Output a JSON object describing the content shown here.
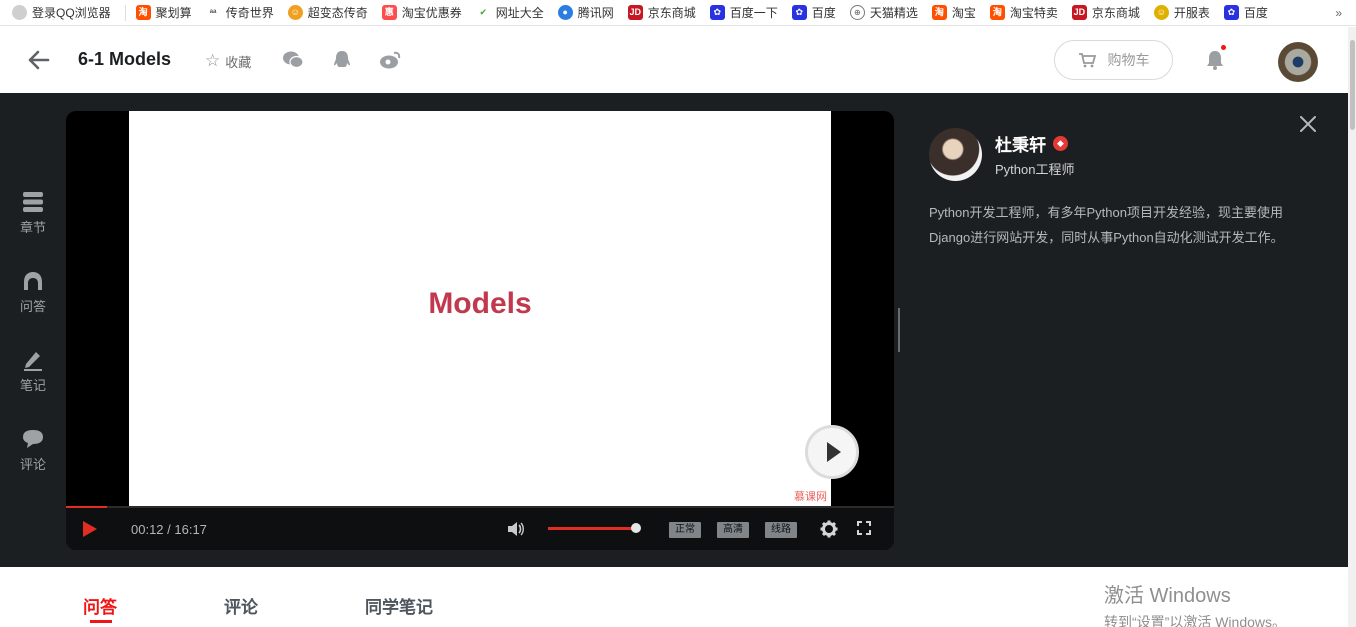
{
  "bookmarks": [
    {
      "label": "登录QQ浏览器",
      "icon": "user-icon",
      "color": "#cfcfcf"
    },
    {
      "label": "聚划算",
      "icon": "taobao-icon",
      "color": "#ff5000"
    },
    {
      "label": "传奇世界",
      "icon": "game-icon",
      "color": "#555555"
    },
    {
      "label": "超变态传奇",
      "icon": "smile-icon",
      "color": "#f0a020"
    },
    {
      "label": "淘宝优惠券",
      "icon": "coupon-icon",
      "color": "#ff4d4d"
    },
    {
      "label": "网址大全",
      "icon": "hao123-icon",
      "color": "#3fae29"
    },
    {
      "label": "腾讯网",
      "icon": "tencent-icon",
      "color": "#2a7de1"
    },
    {
      "label": "京东商城",
      "icon": "jd-icon",
      "color": "#c81623"
    },
    {
      "label": "百度一下",
      "icon": "baidu-icon",
      "color": "#2932e1"
    },
    {
      "label": "百度",
      "icon": "baidu-icon",
      "color": "#2932e1"
    },
    {
      "label": "天猫精选",
      "icon": "globe-icon",
      "color": "#777777"
    },
    {
      "label": "淘宝",
      "icon": "taobao-icon",
      "color": "#ff5000"
    },
    {
      "label": "淘宝特卖",
      "icon": "taobao-icon",
      "color": "#ff5000"
    },
    {
      "label": "京东商城",
      "icon": "jd-icon",
      "color": "#c81623"
    },
    {
      "label": "开服表",
      "icon": "smile-icon",
      "color": "#e0b000"
    },
    {
      "label": "百度",
      "icon": "baidu-icon",
      "color": "#2932e1"
    }
  ],
  "bookmarks_more": "»",
  "header": {
    "title": "6-1 Models",
    "favorite_label": "收藏",
    "cart_label": "购物车"
  },
  "sidenav": [
    {
      "label": "章节",
      "icon": "chapters-icon"
    },
    {
      "label": "问答",
      "icon": "qa-icon"
    },
    {
      "label": "笔记",
      "icon": "note-icon"
    },
    {
      "label": "评论",
      "icon": "comment-icon"
    }
  ],
  "player": {
    "slide_title": "Models",
    "watermark": "慕课网",
    "time": "00:12 / 16:17",
    "progress": 0.0123,
    "volume": 0.9,
    "quality_buttons": [
      "正常",
      "高清",
      "线路"
    ]
  },
  "teacher": {
    "name": "杜秉轩",
    "role": "Python工程师",
    "description": "Python开发工程师，有多年Python项目开发经验，现主要使用Django进行网站开发，同时从事Python自动化测试开发工作。"
  },
  "tabs": [
    "问答",
    "评论",
    "同学笔记"
  ],
  "active_tab": "问答",
  "os_watermark": {
    "line1": "激活 Windows",
    "line2": "转到“设置”以激活 Windows。"
  },
  "colors": {
    "accent": "#f01414",
    "dark_bg": "#1c1f21",
    "slide_title": "#c0394f"
  }
}
